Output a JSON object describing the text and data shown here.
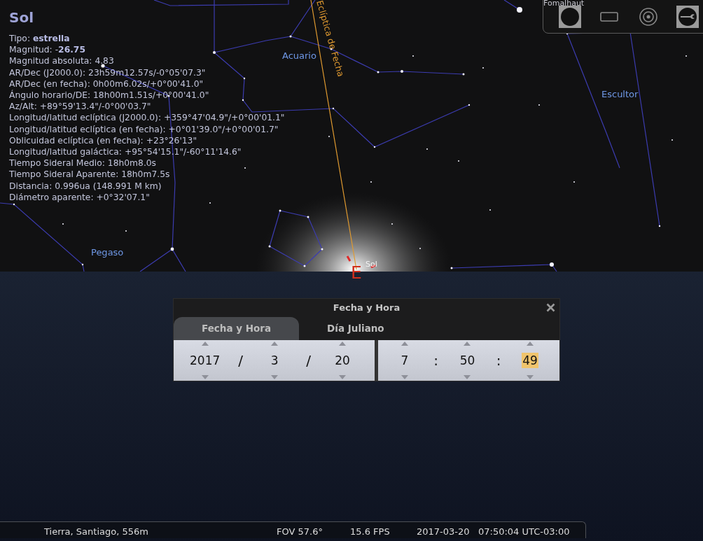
{
  "object_info": {
    "title": "Sol",
    "lines": [
      "Tipo: **estrella**",
      "Magnitud: -**26.75**",
      "Magnitud absoluta: 4.83",
      "AR/Dec (J2000.0): 23h59m12.57s/-0°05'07.3\"",
      "AR/Dec (en fecha): 0h00m6.02s/+0°00'41.0\"",
      "Ángulo horario/DE: 18h00m1.51s/+0°00'41.0\"",
      "Az/Alt: +89°59'13.4\"/-0°00'03.7\"",
      "Longitud/latitud eclíptica (J2000.0): +359°47'04.9\"/+0°00'01.1\"",
      "Longitud/latitud eclíptica (en fecha): +0°01'39.0\"/+0°00'01.7\"",
      "Oblicuidad eclíptica (en fecha): +23°26'13\"",
      "Longitud/latitud galáctica: +95°54'15.1\"/-60°11'14.6\"",
      "Tiempo Sideral Medio: 18h0m8.0s",
      "Tiempo Sideral Aparente: 18h0m7.5s",
      "Distancia: 0.996ua (148.991 M km)",
      "Diámetro aparente: +0°32'07.1\""
    ]
  },
  "sky_labels": [
    {
      "kind": "star",
      "text": "Fomalhaut"
    },
    {
      "kind": "constellation",
      "text": "Acuario"
    },
    {
      "kind": "ecliptic",
      "text": "Eclíptica de Fecha"
    },
    {
      "kind": "constellation",
      "text": "Escultor"
    },
    {
      "kind": "constellation",
      "text": "Pegaso"
    },
    {
      "kind": "planet",
      "text": "Sol"
    },
    {
      "kind": "cardinal",
      "text": "E"
    }
  ],
  "toolbar": [
    {
      "kind": "disk",
      "on": true
    },
    {
      "kind": "rect",
      "on": false
    },
    {
      "kind": "target",
      "on": false
    },
    {
      "kind": "wrench",
      "on": true
    }
  ],
  "dialog": {
    "title": "Fecha y Hora",
    "tabs": [
      {
        "label": "Fecha y Hora",
        "selected": true
      },
      {
        "label": "Día Juliano",
        "selected": false
      }
    ],
    "date": [
      {
        "kind": "field",
        "text": "2017",
        "highlighted": false
      },
      {
        "kind": "sep",
        "text": "/"
      },
      {
        "kind": "field",
        "text": "3",
        "highlighted": false
      },
      {
        "kind": "sep",
        "text": "/"
      },
      {
        "kind": "field",
        "text": "20",
        "highlighted": false
      }
    ],
    "time": [
      {
        "kind": "field",
        "text": "7",
        "highlighted": false
      },
      {
        "kind": "sep",
        "text": ":"
      },
      {
        "kind": "field",
        "text": "50",
        "highlighted": false
      },
      {
        "kind": "sep",
        "text": ":"
      },
      {
        "kind": "field",
        "text": "49",
        "highlighted": true
      }
    ]
  },
  "status_bar": {
    "location": "Tierra, Santiago, 556m",
    "fov": "FOV 57.6°",
    "fps": "15.6 FPS",
    "date": "2017-03-20",
    "time": "07:50:04 UTC-03:00"
  }
}
